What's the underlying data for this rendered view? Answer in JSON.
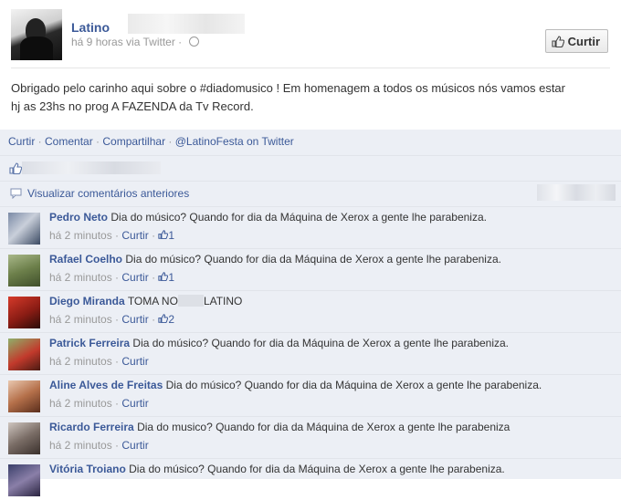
{
  "post": {
    "author": "Latino",
    "time": "há 9 horas via Twitter",
    "separator": " · ",
    "like_button": "Curtir",
    "text_line1": "Obrigado pelo carinho aqui sobre o #diadomusico ! Em homenagem a todos os músicos nós vamos estar",
    "text_line2": "hj as 23hs no prog A FAZENDA da Tv Record."
  },
  "actions": {
    "like": "Curtir",
    "comment": "Comentar",
    "share": "Compartilhar",
    "twitter": "@LatinoFesta on Twitter",
    "dot": " · "
  },
  "ufi": {
    "view_previous": "Visualizar comentários anteriores"
  },
  "comments": [
    {
      "name": "Pedro Neto",
      "text": "Dia do músico? Quando for dia da Máquina de Xerox a gente lhe parabeniza.",
      "time": "há 2 minutos",
      "like": "Curtir",
      "likes": "1"
    },
    {
      "name": "Rafael Coelho",
      "text": "Dia do músico? Quando for dia da Máquina de Xerox a gente lhe parabeniza.",
      "time": "há 2 minutos",
      "like": "Curtir",
      "likes": "1"
    },
    {
      "name": "Diego Miranda",
      "text_a": "TOMA NO",
      "text_b": "LATINO",
      "time": "há 2 minutos",
      "like": "Curtir",
      "likes": "2"
    },
    {
      "name": "Patrick Ferreira",
      "text": "Dia do músico? Quando for dia da Máquina de Xerox a gente lhe parabeniza.",
      "time": "há 2 minutos",
      "like": "Curtir"
    },
    {
      "name": "Aline Alves de Freitas",
      "text": "Dia do músico? Quando for dia da Máquina de Xerox a gente lhe parabeniza.",
      "time": "há 2 minutos",
      "like": "Curtir"
    },
    {
      "name": "Ricardo Ferreira",
      "text": "Dia do musico? Quando for dia da Máquina de Xerox a gente lhe parabeniza",
      "time": "há 2 minutos",
      "like": "Curtir"
    },
    {
      "name": "Vitória Troiano",
      "text": "Dia do músico? Quando for dia da Máquina de Xerox a gente lhe parabeniza."
    }
  ],
  "colors": {
    "link": "#3b5998",
    "muted": "#999999",
    "ufi_bg": "#eceff5"
  }
}
